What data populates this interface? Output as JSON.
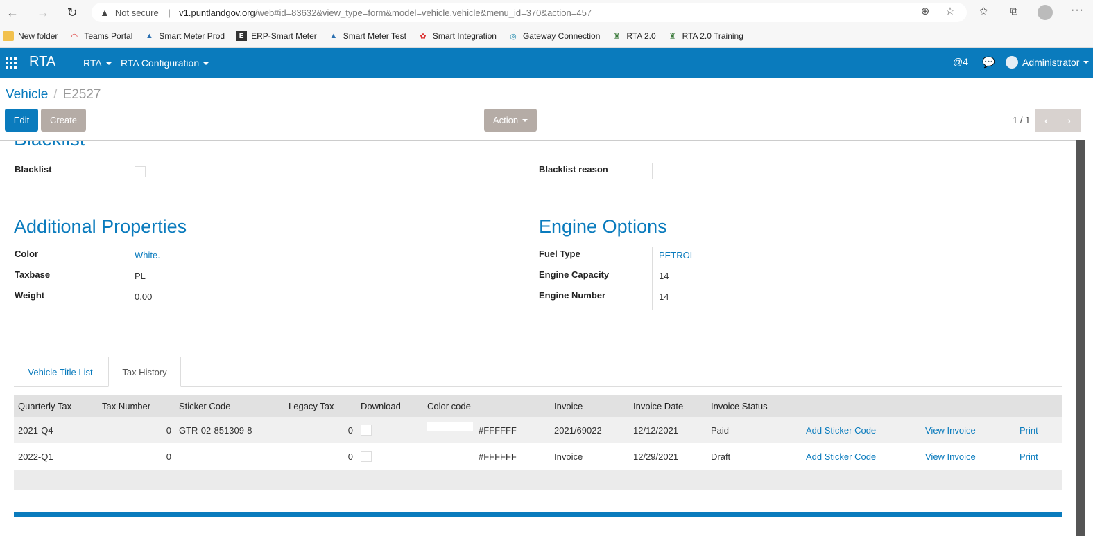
{
  "browser": {
    "not_secure": "Not secure",
    "url_host": "v1.puntlandgov.org",
    "url_path": "/web#id=83632&view_type=form&model=vehicle.vehicle&menu_id=370&action=457"
  },
  "bookmarks": [
    {
      "label": "New folder",
      "icon": "folder-icon"
    },
    {
      "label": "Teams Portal",
      "icon": "gauge-icon"
    },
    {
      "label": "Smart Meter Prod",
      "icon": "drop-icon"
    },
    {
      "label": "ERP-Smart Meter",
      "icon": "e-icon"
    },
    {
      "label": "Smart Meter Test",
      "icon": "drop-icon"
    },
    {
      "label": "Smart Integration",
      "icon": "huawei-icon"
    },
    {
      "label": "Gateway Connection",
      "icon": "swirl-icon"
    },
    {
      "label": "RTA 2.0",
      "icon": "emblem-icon"
    },
    {
      "label": "RTA 2.0 Training",
      "icon": "emblem-icon"
    }
  ],
  "appnav": {
    "brand": "RTA",
    "menu_rta": "RTA",
    "menu_config": "RTA Configuration",
    "mentions": "@4",
    "user": "Administrator"
  },
  "control": {
    "breadcrumb_root": "Vehicle",
    "breadcrumb_sep": "/",
    "breadcrumb_current": "E2527",
    "edit_label": "Edit",
    "create_label": "Create",
    "action_label": "Action",
    "pager": "1 / 1",
    "prev": "‹",
    "next": "›"
  },
  "form": {
    "blacklist_title": "Blacklist",
    "blacklist_label": "Blacklist",
    "blacklist_reason_label": "Blacklist reason",
    "additional_title": "Additional Properties",
    "color_label": "Color",
    "color_value": "White.",
    "taxbase_label": "Taxbase",
    "taxbase_value": "PL",
    "weight_label": "Weight",
    "weight_value": "0.00",
    "engine_title": "Engine Options",
    "fuel_label": "Fuel Type",
    "fuel_value": "PETROL",
    "capacity_label": "Engine Capacity",
    "capacity_value": "14",
    "engine_number_label": "Engine Number",
    "engine_number_value": "14"
  },
  "tabs": {
    "vehicle_title_list": "Vehicle Title List",
    "tax_history": "Tax History"
  },
  "table": {
    "headers": {
      "quarterly_tax": "Quarterly Tax",
      "tax_number": "Tax Number",
      "sticker_code": "Sticker Code",
      "legacy_tax": "Legacy Tax",
      "download": "Download",
      "color_code": "Color code",
      "invoice": "Invoice",
      "invoice_date": "Invoice Date",
      "invoice_status": "Invoice Status"
    },
    "rows": [
      {
        "quarterly_tax": "2021-Q4",
        "tax_number": "0",
        "sticker_code": "GTR-02-851309-8",
        "legacy_tax": "0",
        "color_code": "#FFFFFF",
        "invoice": "2021/69022",
        "invoice_date": "12/12/2021",
        "invoice_status": "Paid",
        "add_sticker": "Add Sticker Code",
        "view_invoice": "View Invoice",
        "print": "Print"
      },
      {
        "quarterly_tax": "2022-Q1",
        "tax_number": "0",
        "sticker_code": "",
        "legacy_tax": "0",
        "color_code": "#FFFFFF",
        "invoice": "Invoice",
        "invoice_date": "12/29/2021",
        "invoice_status": "Draft",
        "add_sticker": "Add Sticker Code",
        "view_invoice": "View Invoice",
        "print": "Print"
      }
    ]
  },
  "colors": {
    "primary": "#0a7bbd",
    "secondary": "#b5aca6"
  }
}
